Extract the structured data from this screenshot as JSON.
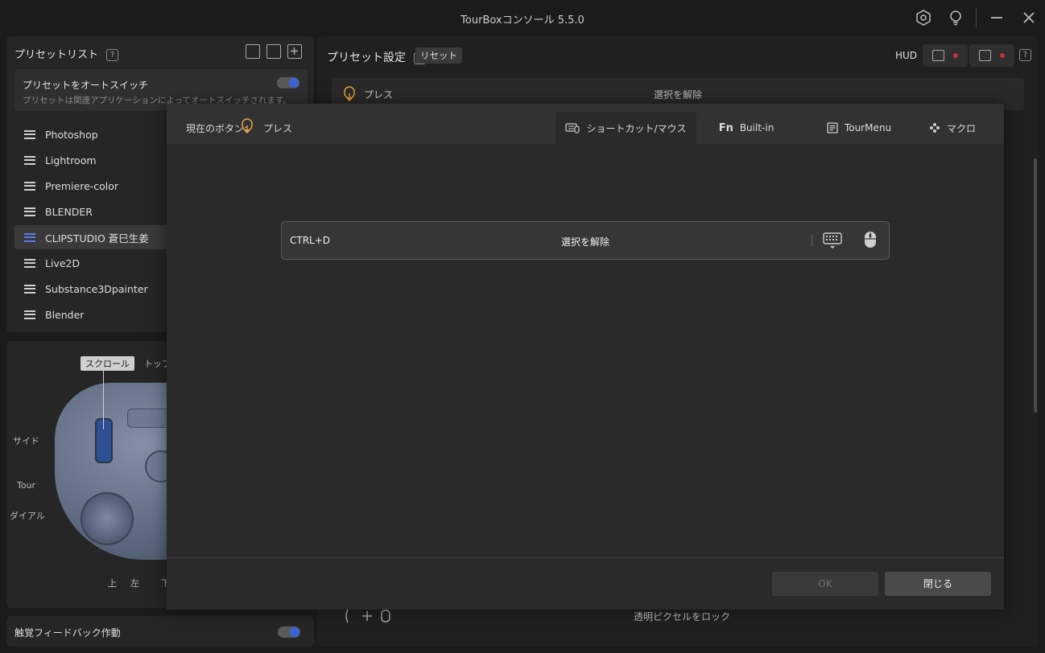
{
  "window": {
    "title": "TourBoxコンソール 5.5.0"
  },
  "preset_list": {
    "header": "プリセットリスト",
    "help": "?",
    "autoswitch": {
      "title": "プリセットをオートスイッチ",
      "description": "プリセットは関連アプリケーションによってオートスイッチされます。",
      "enabled": true
    },
    "items": [
      {
        "label": "Photoshop"
      },
      {
        "label": "Lightroom"
      },
      {
        "label": "Premiere-color"
      },
      {
        "label": "BLENDER"
      },
      {
        "label": "CLIPSTUDIO 蒼巳生姜",
        "selected": true
      },
      {
        "label": "Live2D"
      },
      {
        "label": "Substance3Dpainter"
      },
      {
        "label": "Blender"
      }
    ]
  },
  "device": {
    "scroll_tag": "スクロール",
    "labels": {
      "top": "トップ",
      "side": "サイド",
      "tour": "Tour",
      "dial": "ダイアル",
      "up": "上",
      "left": "左",
      "down": "下"
    }
  },
  "haptic": {
    "label": "触覚フィードバック作動",
    "enabled": true
  },
  "preset_settings": {
    "title": "プリセット設定",
    "help": "?",
    "reset": "リセット",
    "hud": "HUD",
    "row_top": {
      "name": "プレス",
      "action": "選択を解除"
    },
    "row_bottom": {
      "action": "透明ピクセルをロック"
    }
  },
  "modal": {
    "current_button_label": "現在のボタン:",
    "current_button_name": "プレス",
    "tabs": [
      {
        "label": "ショートカット/マウス",
        "active": true
      },
      {
        "label": "Built-in"
      },
      {
        "label": "TourMenu"
      },
      {
        "label": "マクロ"
      }
    ],
    "shortcut": "CTRL+D",
    "action_name": "選択を解除",
    "ok": "OK",
    "close": "閉じる"
  },
  "colors": {
    "accent": "#3d63d8",
    "orange": "#e8a040",
    "record": "#c83030"
  }
}
